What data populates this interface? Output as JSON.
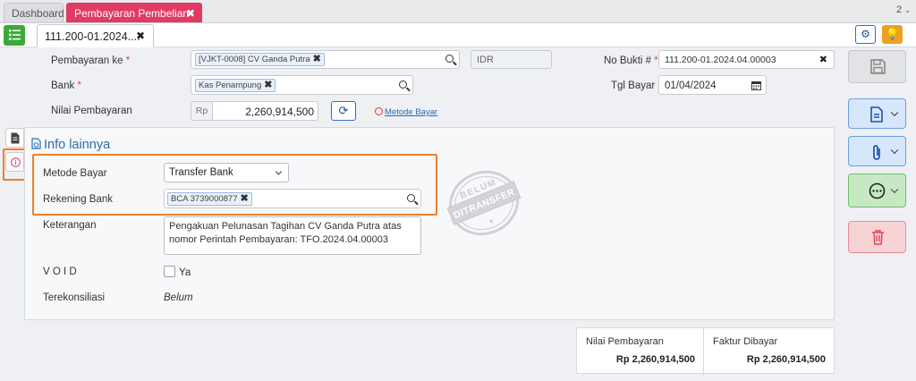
{
  "tabs": {
    "dashboard": "Dashboard",
    "active": "Pembayaran Pembelian",
    "count": "2"
  },
  "document_tab": "111.200-01.2024....",
  "form": {
    "pembayaran_ke_label": "Pembayaran ke",
    "pembayaran_ke_value": "[VJKT-0008] CV Ganda Putra",
    "currency": "IDR",
    "no_bukti_label": "No Bukti #",
    "no_bukti_value": "111.200-01.2024.04.00003",
    "bank_label": "Bank",
    "bank_value": "Kas Penampung",
    "tgl_bayar_label": "Tgl Bayar",
    "tgl_bayar_value": "01/04/2024",
    "nilai_label": "Nilai Pembayaran",
    "nilai_prefix": "Rp",
    "nilai_value": "2,260,914,500",
    "metode_link": "Metode Bayar",
    "required_mark": "*"
  },
  "info": {
    "title": "Info lainnya",
    "metode_label": "Metode Bayar",
    "metode_value": "Transfer Bank",
    "rekening_label": "Rekening Bank",
    "rekening_value": "BCA 3739000877",
    "keterangan_label": "Keterangan",
    "keterangan_value": "Pengakuan Pelunasan Tagihan CV Ganda Putra atas nomor Perintah Pembayaran: TFO.2024.04.00003",
    "void_label": "V O I D",
    "void_option": "Ya",
    "terekonsiliasi_label": "Terekonsiliasi",
    "terekonsiliasi_value": "Belum"
  },
  "stamp": {
    "line1": "BELUM",
    "line2": "DITRANSFER"
  },
  "summary": {
    "nilai_label": "Nilai Pembayaran",
    "nilai_value": "Rp 2,260,914,500",
    "faktur_label": "Faktur Dibayar",
    "faktur_value": "Rp 2,260,914,500"
  },
  "colors": {
    "accent_pink": "#e03b63",
    "accent_blue": "#2b6cb0",
    "highlight_orange": "#f07f2a"
  }
}
